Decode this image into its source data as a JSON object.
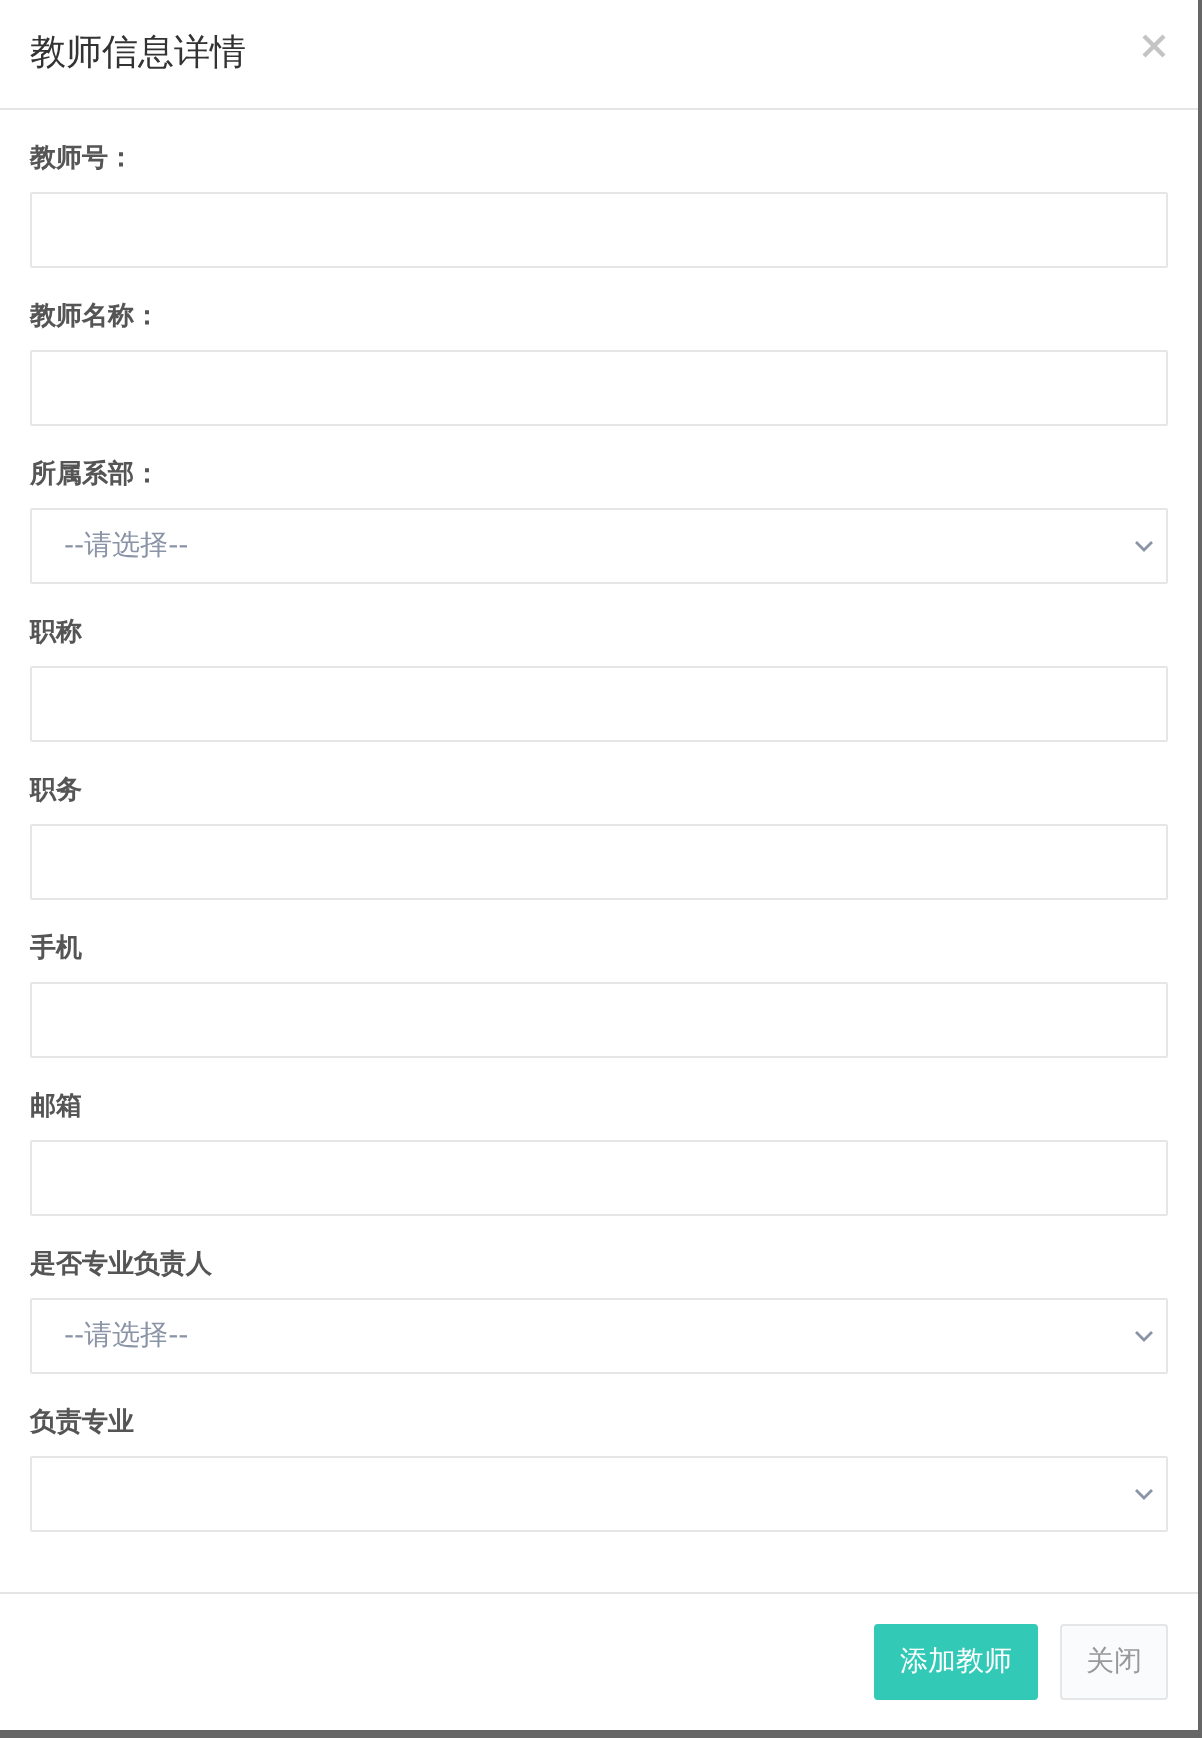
{
  "dialog": {
    "title": "教师信息详情",
    "fields": [
      {
        "label": "教师号：",
        "kind": "input"
      },
      {
        "label": "教师名称：",
        "kind": "input"
      },
      {
        "label": "所属系部：",
        "kind": "select",
        "placeholder": "--请选择--"
      },
      {
        "label": "职称",
        "kind": "input"
      },
      {
        "label": "职务",
        "kind": "input"
      },
      {
        "label": "手机",
        "kind": "input"
      },
      {
        "label": "邮箱",
        "kind": "input"
      },
      {
        "label": "是否专业负责人",
        "kind": "select",
        "placeholder": "--请选择--"
      },
      {
        "label": "负责专业",
        "kind": "select"
      }
    ],
    "buttons": [
      {
        "label": "添加教师",
        "kind": "primary"
      },
      {
        "label": "关闭",
        "kind": "default"
      }
    ]
  }
}
